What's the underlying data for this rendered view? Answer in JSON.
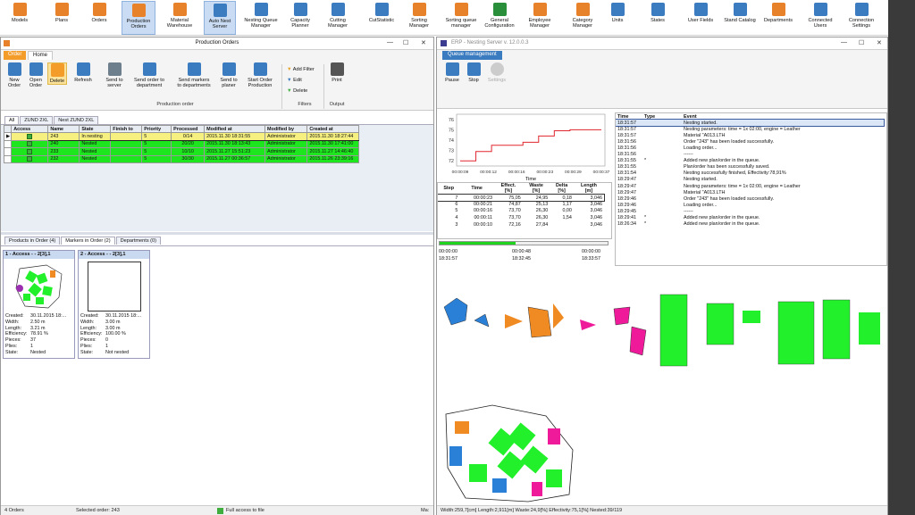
{
  "app_toolbar": [
    {
      "label1": "Models",
      "label2": "",
      "icon": "models-icon",
      "color": "#e8822a"
    },
    {
      "label1": "Plans",
      "label2": "",
      "icon": "plans-icon",
      "color": "#e8822a"
    },
    {
      "label1": "Orders",
      "label2": "",
      "icon": "orders-icon",
      "color": "#e8822a"
    },
    {
      "label1": "Production",
      "label2": "Orders",
      "icon": "production-orders-icon",
      "color": "#e8822a"
    },
    {
      "label1": "Material",
      "label2": "Warehouse",
      "icon": "material-warehouse-icon",
      "color": "#e8822a"
    },
    {
      "label1": "Auto Nest",
      "label2": "Server",
      "icon": "auto-nest-server-icon",
      "color": "#3b7bbf"
    },
    {
      "label1": "Nesting Queue",
      "label2": "Manager",
      "icon": "nesting-queue-icon",
      "color": "#3b7bbf"
    },
    {
      "label1": "Capacity",
      "label2": "Planner",
      "icon": "capacity-planner-icon",
      "color": "#3b7bbf"
    },
    {
      "label1": "Cutting",
      "label2": "Manager",
      "icon": "cutting-manager-icon",
      "color": "#3b7bbf"
    },
    {
      "label1": "CutStatistic",
      "label2": "",
      "icon": "cut-statistic-icon",
      "color": "#3b7bbf"
    },
    {
      "label1": "Sorting",
      "label2": "Manager",
      "icon": "sorting-manager-icon",
      "color": "#e8822a"
    },
    {
      "label1": "Sorting queue",
      "label2": "manager",
      "icon": "sorting-queue-icon",
      "color": "#e8822a"
    },
    {
      "label1": "General",
      "label2": "Configuration",
      "icon": "general-configuration-icon",
      "color": "#2a8f3a"
    },
    {
      "label1": "Employee",
      "label2": "Manager",
      "icon": "employee-manager-icon",
      "color": "#e8822a"
    },
    {
      "label1": "Category",
      "label2": "Manager",
      "icon": "category-manager-icon",
      "color": "#e8822a"
    },
    {
      "label1": "Units",
      "label2": "",
      "icon": "units-icon",
      "color": "#3b7bbf"
    },
    {
      "label1": "States",
      "label2": "",
      "icon": "states-icon",
      "color": "#3b7bbf"
    },
    {
      "label1": "User Fields",
      "label2": "",
      "icon": "user-fields-icon",
      "color": "#3b7bbf"
    },
    {
      "label1": "Stand Catalog",
      "label2": "",
      "icon": "stand-catalog-icon",
      "color": "#3b7bbf"
    },
    {
      "label1": "Departments",
      "label2": "",
      "icon": "departments-icon",
      "color": "#e8822a"
    },
    {
      "label1": "Connected",
      "label2": "Users",
      "icon": "connected-users-icon",
      "color": "#3b7bbf"
    },
    {
      "label1": "Connection",
      "label2": "Settings",
      "icon": "connection-settings-icon",
      "color": "#3b7bbf"
    }
  ],
  "po": {
    "title": "Production Orders",
    "tab_order": "Order",
    "tab_home": "Home",
    "buttons": [
      {
        "l1": "New",
        "l2": "Order"
      },
      {
        "l1": "Open",
        "l2": "Order"
      },
      {
        "l1": "Delete",
        "l2": ""
      },
      {
        "l1": "Refresh",
        "l2": ""
      },
      {
        "l1": "Send to",
        "l2": "server"
      },
      {
        "l1": "Send order to",
        "l2": "department"
      },
      {
        "l1": "Send markers",
        "l2": "to departments"
      },
      {
        "l1": "Send to",
        "l2": "planer"
      },
      {
        "l1": "Start Order",
        "l2": "Production"
      }
    ],
    "group_production": "Production order",
    "filters": {
      "add": "Add Filter",
      "edit": "Edit",
      "delete": "Delete",
      "group": "Filters"
    },
    "print": "Print",
    "group_output": "Output",
    "view_tabs": [
      "All",
      "ZUND 2XL",
      "Nest ZUND 2XL"
    ],
    "columns": [
      "Access",
      "Name",
      "State",
      "Finish to",
      "Priority",
      "Processed",
      "Modified at",
      "Modified by",
      "Created at"
    ],
    "rows": [
      {
        "name": "243",
        "state": "In nesting",
        "finish": "",
        "priority": "5",
        "processed": "0/14",
        "modified": "2015.11.30 18:31:55",
        "by": "Administrator",
        "created": "2015.11.30 18:27:44"
      },
      {
        "name": "240",
        "state": "Nested",
        "finish": "",
        "priority": "5",
        "processed": "20/20",
        "modified": "2015.11.30 18:13:43",
        "by": "Administrator",
        "created": "2015.11.30 17:41:00"
      },
      {
        "name": "233",
        "state": "Nested",
        "finish": "",
        "priority": "5",
        "processed": "10/10",
        "modified": "2015.11.27 15:51:23",
        "by": "Administrator",
        "created": "2015.11.27 14:46:40"
      },
      {
        "name": "232",
        "state": "Nested",
        "finish": "",
        "priority": "5",
        "processed": "30/30",
        "modified": "2015.11.27 00:36:57",
        "by": "Administrator",
        "created": "2015.11.26 23:39:16"
      }
    ],
    "bottom_tabs": [
      "Products in Order (4)",
      "Markers in Order (2)",
      "Departments (0)"
    ],
    "markers": [
      {
        "header": "1 - Access -  - 2[3],1",
        "created": "30.11.2015 18:...",
        "width": "2.50 m",
        "length": "3.21 m",
        "efficiency": "78.91 %",
        "pieces": "37",
        "plies": "1",
        "state": "Nested"
      },
      {
        "header": "2 - Access -  - 2[3],1",
        "created": "30.11.2015 18:...",
        "width": "3.00 m",
        "length": "3.00 m",
        "efficiency": "100.00 %",
        "pieces": "0",
        "plies": "1",
        "state": "Not nested"
      }
    ],
    "marker_labels": {
      "created": "Created:",
      "width": "Width:",
      "length": "Length:",
      "efficiency": "Efficiency:",
      "pieces": "Pieces:",
      "plies": "Plies:",
      "state": "State:"
    },
    "status": {
      "orders": "4 Orders",
      "selected": "Selected order: 243",
      "access": "Full access to file",
      "mark": "Ma:"
    }
  },
  "ns": {
    "title": "ERP - Nesting Server v. 12.0.0.3",
    "tab": "Queue management",
    "buttons": [
      "Pause",
      "Stop",
      "Settings"
    ],
    "chart": {
      "y_ticks": [
        "76",
        "75",
        "74",
        "73",
        "72"
      ],
      "x_ticks": [
        "00:00:09",
        "00:00:12",
        "00:00:16",
        "00:00:23",
        "00:00:29",
        "00:00:37"
      ],
      "xlabel": "Time"
    },
    "chart_data": {
      "type": "line",
      "xlabel": "Time",
      "ylim": [
        71.5,
        76.5
      ],
      "x": [
        "00:00:09",
        "00:00:10",
        "00:00:12",
        "00:00:16",
        "00:00:18",
        "00:00:23",
        "00:00:24",
        "00:00:29",
        "00:00:37",
        "00:00:40"
      ],
      "series": [
        {
          "values": [
            72.0,
            72.9,
            73.5,
            73.5,
            73.8,
            74.4,
            74.9,
            75.0,
            75.0,
            75.0
          ]
        }
      ]
    },
    "step_cols": [
      "Step",
      "Time",
      "Effect.\n[%]",
      "Waste\n[%]",
      "Delta\n[%]",
      "Length\n[m]"
    ],
    "step_cols_short": [
      "Step",
      "Time",
      "Effect.",
      "Waste",
      "Delta",
      "Length"
    ],
    "step_units": [
      "",
      "",
      "[%]",
      "[%]",
      "[%]",
      "[m]"
    ],
    "steps": [
      [
        "7",
        "00:00:23",
        "75,05",
        "24,95",
        "0,18",
        "3,046"
      ],
      [
        "6",
        "00:00:21",
        "74,87",
        "25,13",
        "1,17",
        "3,046"
      ],
      [
        "5",
        "00:00:16",
        "73,70",
        "26,30",
        "0,00",
        "3,046"
      ],
      [
        "4",
        "00:00:11",
        "73,70",
        "26,30",
        "1,54",
        "3,046"
      ],
      [
        "3",
        "00:00:10",
        "72,16",
        "27,84",
        "",
        "3,046"
      ]
    ],
    "progress": {
      "elapsed": "00:00:00",
      "mid": "00:00:48",
      "total": "00:00:00",
      "start": "18:31:57",
      "mid2": "18:32:45",
      "end": "18:33:57",
      "fraction": 0.45
    },
    "log_cols": [
      "Time",
      "Type",
      "Event"
    ],
    "log": [
      [
        "18:31:57",
        "",
        "Nesting started."
      ],
      [
        "18:31:57",
        "",
        "Nesting parameters: time = 1x 02:00, engine = Leather"
      ],
      [
        "18:31:57",
        "",
        "Material \"A013.LTH"
      ],
      [
        "18:31:56",
        "",
        "Order \"243\" has been loaded successfully."
      ],
      [
        "18:31:56",
        "",
        "Loading order..."
      ],
      [
        "18:31:56",
        "",
        "------"
      ],
      [
        "18:31:55",
        "*",
        "Added new plan/order in the queue."
      ],
      [
        "18:31:55",
        "",
        "Plan/order has been successfully saved."
      ],
      [
        "18:31:54",
        "",
        "Nesting successfully finished, Effectivity:78,91%"
      ],
      [
        "18:29:47",
        "",
        "Nesting started."
      ],
      [
        "18:29:47",
        "",
        "Nesting parameters: time = 1x 02:00, engine = Leather"
      ],
      [
        "18:29:47",
        "",
        "Material \"A013.LTH"
      ],
      [
        "18:29:46",
        "",
        "Order \"243\" has been loaded successfully."
      ],
      [
        "18:29:46",
        "",
        "Loading order..."
      ],
      [
        "18:29:45",
        "",
        "------"
      ],
      [
        "18:29:41",
        "*",
        "Added new plan/order in the queue."
      ],
      [
        "18:26:34",
        "*",
        "Added new plan/order in the queue."
      ]
    ],
    "status": "Width:259,7[cm]  Length:2,911[m]  Waste:24,9[%]  Effectivity:75,1[%]  Nested:39/119"
  },
  "colors": {
    "green_row": "#1ee61e",
    "selected_row": "#f6f080",
    "accent": "#3b7bbf",
    "piece_green": "#22f02a",
    "piece_orange": "#f08a22",
    "piece_blue": "#2a7fd6",
    "piece_magenta": "#ee1a9a"
  }
}
